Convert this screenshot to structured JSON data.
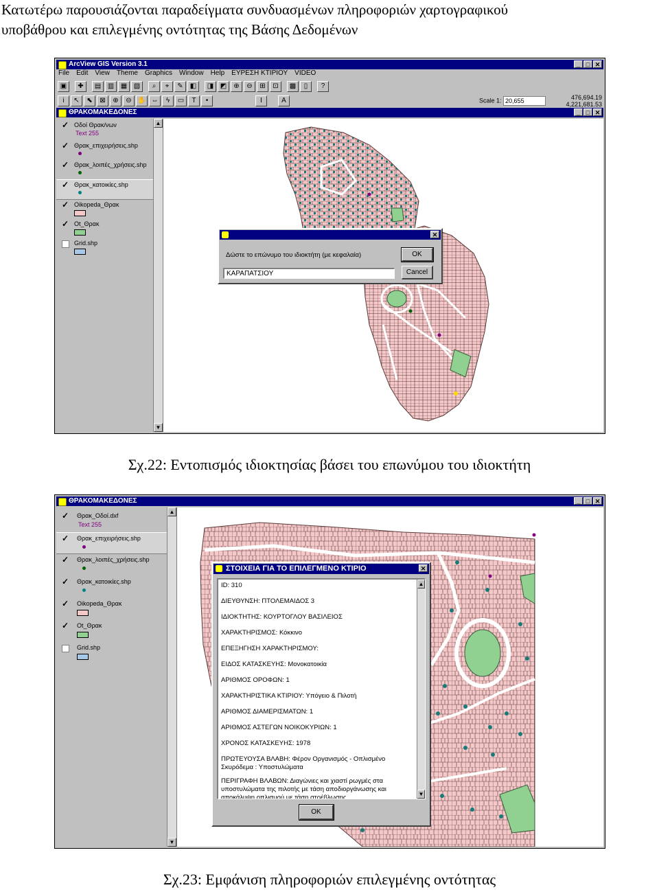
{
  "intro_text": "Κατωτέρω παρουσιάζονται παραδείγματα συνδυασμένων πληροφοριών χαρτογραφικού\nυποβάθρου και επιλεγμένης οντότητας της Βάσης Δεδομένων",
  "figure1": {
    "app_title": "ArcView GIS Version 3.1",
    "menu": [
      "File",
      "Edit",
      "View",
      "Theme",
      "Graphics",
      "Window",
      "Help",
      "ΕΥΡΕΣΗ ΚΤΙΡΙΟΥ",
      "VIDEO"
    ],
    "scale_label": "Scale 1:",
    "scale_value": "20,655",
    "coord_x": "476,694.19",
    "coord_y": "4,221,681.53",
    "tool_i": "I",
    "tool_a": "A",
    "view_title": "ΘΡΑΚΟΜΑΚΕΔΟΝΕΣ",
    "legend": [
      {
        "label": "Οδοί Θρακ/νων",
        "checked": true,
        "symbol_text": "Text 255"
      },
      {
        "label": "Θρακ_επιχειρήσεις.shp",
        "checked": true,
        "symbol_color": "#800080"
      },
      {
        "label": "Θρακ_λοιπές_χρήσεις.shp",
        "checked": true,
        "symbol_color": "#006000"
      },
      {
        "label": "Θρακ_κατοικίες.shp",
        "checked": true,
        "symbol_color": "#008080",
        "active": true
      },
      {
        "label": "Oikopeda_Θρακ",
        "checked": true,
        "symbol_color": "#f4c8c8"
      },
      {
        "label": "Ot_Θρακ",
        "checked": true,
        "symbol_color": "#90d090"
      },
      {
        "label": "Grid.shp",
        "checked": false,
        "symbol_color": "#a8c8e8"
      }
    ],
    "dialog": {
      "prompt": "Δώστε το επώνυμο του ιδιοκτήτη (με κεφαλαία)",
      "value": "ΚΑΡΑΠΑΤΣΙΟΥ",
      "ok_label": "OK",
      "cancel_label": "Cancel"
    },
    "caption": "Σχ.22: Εντοπισμός ιδιοκτησίας βάσει του επωνύμου του ιδιοκτήτη"
  },
  "figure2": {
    "view_title": "ΘΡΑΚΟΜΑΚΕΔΟΝΕΣ",
    "legend": [
      {
        "label": "Θρακ_Οδοί.dxf",
        "checked": true,
        "symbol_text": "Text 255"
      },
      {
        "label": "Θρακ_επιχειρήσεις.shp",
        "checked": true,
        "symbol_color": "#800080",
        "active": true
      },
      {
        "label": "Θρακ_λοιπές_χρήσεις.shp",
        "checked": true,
        "symbol_color": "#006000"
      },
      {
        "label": "Θρακ_κατοικίες.shp",
        "checked": true,
        "symbol_color": "#008080"
      },
      {
        "label": "Oikopeda_Θρακ",
        "checked": true,
        "symbol_color": "#f4c8c8"
      },
      {
        "label": "Ot_Θρακ",
        "checked": true,
        "symbol_color": "#90d090"
      },
      {
        "label": "Grid.shp",
        "checked": false,
        "symbol_color": "#a8c8e8"
      }
    ],
    "dialog": {
      "title": "ΣΤΟΙΧΕΙΑ ΓΙΑ ΤΟ ΕΠΙΛΕΓΜΕΝΟ ΚΤΙΡΙΟ",
      "lines": [
        "ID:  310",
        "ΔΙΕΥΘΥΝΣΗ:  ΠΤΟΛΕΜΑΙΔΟΣ 3",
        "ΙΔΙΟΚΤΗΤΗΣ:  ΚΟΥΡΤΟΓΛΟΥ ΒΑΣΙΛΕΙΟΣ",
        "ΧΑΡΑΚΤΗΡΙΣΜΟΣ:  Κόκκινο",
        "ΕΠΕΞΗΓΗΣΗ ΧΑΡΑΚΤΗΡΙΣΜΟΥ:",
        "ΕΙΔΟΣ ΚΑΤΑΣΚΕΥΗΣ:  Μονοκατοικία",
        "ΑΡΙΘΜΟΣ ΟΡΟΦΩΝ:  1",
        "ΧΑΡΑΚΤΗΡΙΣΤΙΚΑ ΚΤΙΡΙΟΥ:  Υπόγειο & Πιλοτή",
        "ΑΡΙΘΜΟΣ ΔΙΑΜΕΡΙΣΜΑΤΩΝ:  1",
        "ΑΡΙΘΜΟΣ ΑΣΤΕΓΩΝ ΝΟΙΚΟΚΥΡΙΩΝ:  1",
        "ΧΡΟΝΟΣ ΚΑΤΑΣΚΕΥΗΣ:  1978",
        "ΠΡΩΤΕΥΟΥΣΑ ΒΛΑΒΗ:  Φέρον Οργανισμός - Οπλισμένο",
        "Σκυρόδεμα : Υποστυλώματα",
        "ΠΕΡΙΓΡΑΦΗ ΒΛΑΒΩΝ:  Διαγώνιες και χιαστί ρωγμές στα",
        "υποστυλώματα της πιλοτής με τάση αποδιοργάνωσης και",
        "αποκάλυψη οπλισμού με τάση στρέβλωσης."
      ],
      "ok_label": "OK"
    },
    "caption": "Σχ.23: Εμφάνιση πληροφοριών επιλεγμένης οντότητας"
  },
  "colors": {
    "titlebar": "#000080",
    "parcel": "#f4c8c8",
    "building": "#1a7a7a",
    "park": "#90d090",
    "road": "#ffffff"
  }
}
